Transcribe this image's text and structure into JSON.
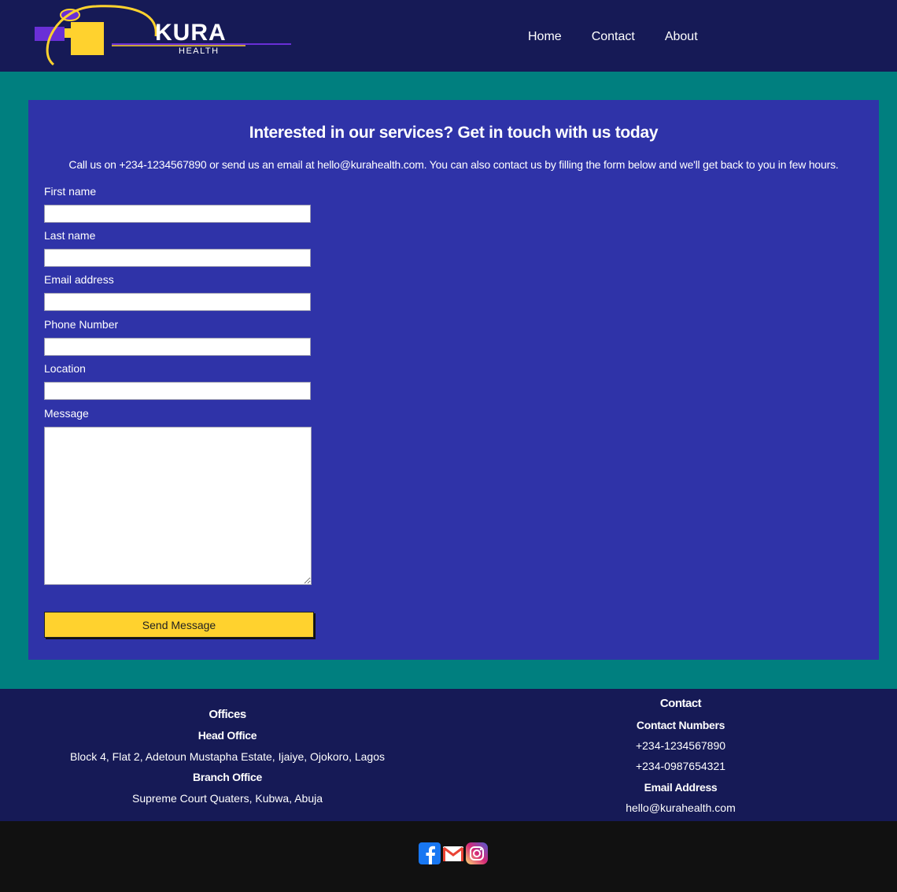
{
  "brand": {
    "name": "KURA",
    "tagline": "HEALTH"
  },
  "nav": {
    "home": "Home",
    "contact": "Contact",
    "about": "About"
  },
  "contact_section": {
    "title": "Interested in our services? Get in touch with us today",
    "intro": "Call us on +234-1234567890 or send us an email at hello@kurahealth.com. You can also contact us by filling the form below and we'll get back to you in few hours.",
    "fields": {
      "first_name": "First name",
      "last_name": "Last name",
      "email": "Email address",
      "phone": "Phone Number",
      "location": "Location",
      "message": "Message"
    },
    "send_label": "Send Message"
  },
  "footer": {
    "offices": {
      "title": "Offices",
      "head_office_title": "Head Office",
      "head_office_address": "Block 4, Flat 2, Adetoun Mustapha Estate, Ijaiye, Ojokoro, Lagos",
      "branch_office_title": "Branch Office",
      "branch_office_address": "Supreme Court Quaters, Kubwa, Abuja"
    },
    "contact": {
      "title": "Contact",
      "numbers_title": "Contact Numbers",
      "number_1": "+234-1234567890",
      "number_2": "+234-0987654321",
      "email_title": "Email Address",
      "email": "hello@kurahealth.com"
    }
  },
  "social": [
    "facebook-icon",
    "gmail-icon",
    "instagram-icon"
  ],
  "colors": {
    "header": "#161a56",
    "teal": "#007f7f",
    "panel": "#2f33a8",
    "accent": "#ffd22e",
    "bottom": "#111111"
  }
}
